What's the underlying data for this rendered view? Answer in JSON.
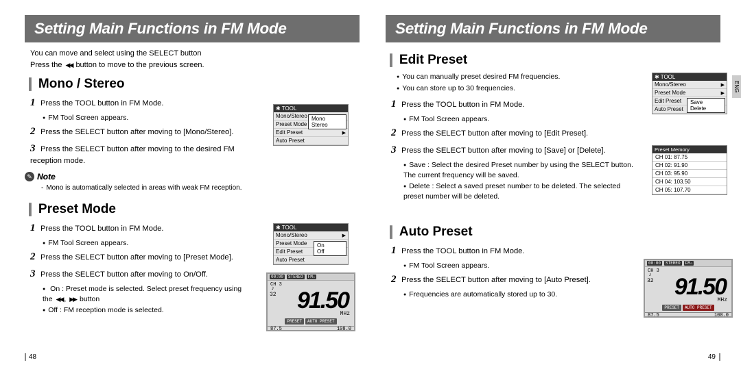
{
  "left": {
    "page_title": "Setting Main Functions in FM Mode",
    "intro": {
      "line1": "You can move and select using the SELECT button",
      "line2_a": "Press the",
      "line2_b": "button to move to the previous screen."
    },
    "mono_stereo": {
      "heading": "Mono / Stereo",
      "step1": "Press the TOOL button in FM Mode.",
      "step1_sub": "FM Tool Screen appears.",
      "step2": "Press the SELECT button after moving to [Mono/Stereo].",
      "step3": "Press the SELECT button after moving to the desired FM reception mode.",
      "note_text": "Mono is automatically selected in areas with weak FM reception.",
      "screen": {
        "title": "TOOL",
        "items": [
          "Mono/Stereo",
          "Preset Mode",
          "Edit Preset",
          "Auto Preset"
        ],
        "popup": [
          "Mono",
          "Stereo"
        ]
      }
    },
    "preset_mode": {
      "heading": "Preset Mode",
      "step1": "Press the TOOL button in FM Mode.",
      "step1_sub": "FM Tool Screen appears.",
      "step2": "Press the SELECT button after moving to [Preset Mode].",
      "step3": "Press the SELECT button after moving to On/Off.",
      "step3_sub1_a": "On : Preset mode is selected. Select preset frequency using the",
      "step3_sub1_b": "button",
      "step3_sub2": "Off : FM reception mode is selected.",
      "screen": {
        "title": "TOOL",
        "items": [
          "Mono/Stereo",
          "Preset Mode",
          "Edit Preset",
          "Auto Preset"
        ],
        "popup": [
          "On",
          "Off"
        ]
      },
      "radio": {
        "status": [
          "00:00",
          "STEREO",
          "FM☆"
        ],
        "ch": "CH 3",
        "vol": "32",
        "freq": "91.50",
        "mhz": "MHz",
        "btn1": "PRESET",
        "btn2": "AUTO PRESET",
        "band_lo": "87.5",
        "band_hi": "108.0"
      }
    },
    "note_label": "Note",
    "page_number": "48"
  },
  "right": {
    "page_title": "Setting Main Functions in FM Mode",
    "edit_preset": {
      "heading": "Edit Preset",
      "intro1": "You can manually preset desired FM frequencies.",
      "intro2": "You can store up to 30 frequencies.",
      "step1": "Press the TOOL button in FM Mode.",
      "step1_sub": "FM Tool Screen appears.",
      "step2": "Press the SELECT button after moving to [Edit Preset].",
      "step3": "Press the SELECT button after moving to [Save] or [Delete].",
      "step3_sub1": "Save : Select the desired Preset number by using the SELECT button. The current frequency will be saved.",
      "step3_sub2": "Delete : Select a saved preset number to be deleted. The selected preset number will be deleted.",
      "screen": {
        "title": "TOOL",
        "items": [
          "Mono/Stereo",
          "Preset Mode",
          "Edit Preset",
          "Auto Preset"
        ],
        "popup": [
          "Save",
          "Delete"
        ]
      },
      "preset_memory": {
        "title": "Preset Memory",
        "rows": [
          "CH 01: 87.75",
          "CH 02: 91.90",
          "CH 03: 95.90",
          "CH 04: 103.50",
          "CH 05: 107.70"
        ]
      }
    },
    "auto_preset": {
      "heading": "Auto Preset",
      "step1": "Press the TOOL button in FM Mode.",
      "step1_sub": "FM Tool Screen appears.",
      "step2": "Press the SELECT button after moving to [Auto Preset].",
      "step2_sub": "Frequencies are automatically stored up to 30.",
      "radio": {
        "status": [
          "00:00",
          "STEREO",
          "FM☆"
        ],
        "ch": "CH 3",
        "vol": "32",
        "freq": "91.50",
        "mhz": "MHz",
        "btn1": "PRESET",
        "btn2": "AUTO PRESET",
        "band_lo": "87.5",
        "band_hi": "108.0"
      }
    },
    "lang": "ENG",
    "page_number": "49"
  }
}
